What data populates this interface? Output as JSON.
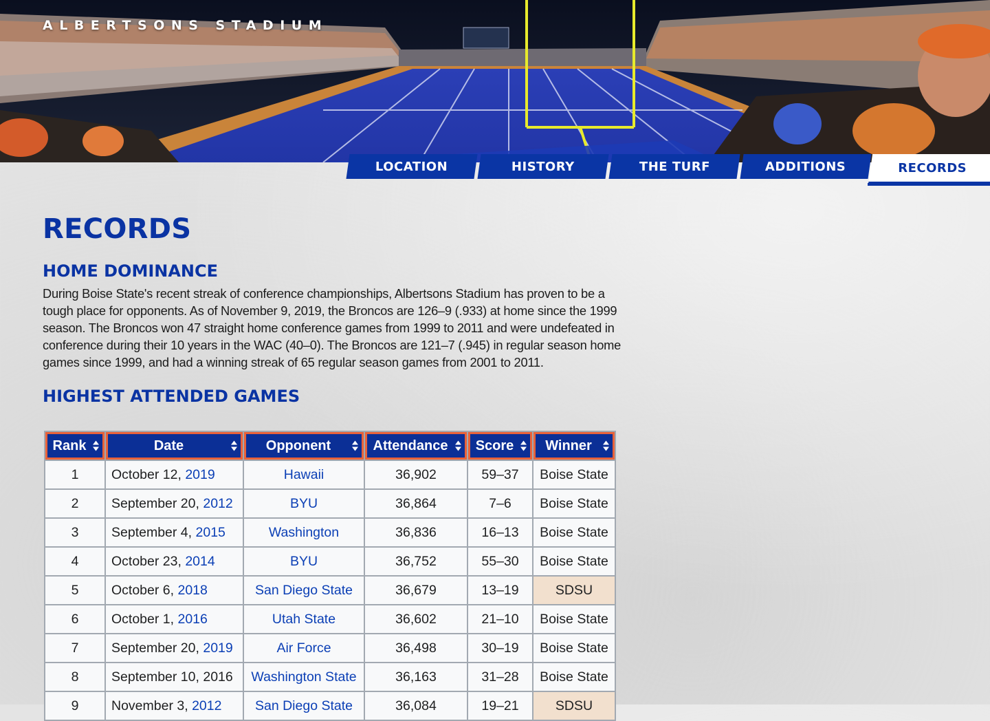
{
  "site": {
    "title": "ALBERTSONS STADIUM"
  },
  "nav": {
    "tabs": [
      {
        "label": "LOCATION",
        "active": false
      },
      {
        "label": "HISTORY",
        "active": false
      },
      {
        "label": "THE TURF",
        "active": false
      },
      {
        "label": "ADDITIONS",
        "active": false
      },
      {
        "label": "RECORDS",
        "active": true
      }
    ]
  },
  "page": {
    "title": "RECORDS",
    "section1": {
      "heading": "HOME DOMINANCE",
      "body": "During Boise State's recent streak of conference championships, Albertsons Stadium has proven to be a tough place for opponents. As of November 9, 2019, the Broncos are 126–9 (.933) at home since the 1999 season. The Broncos won 47 straight home conference games from 1999 to 2011 and were undefeated in conference during their 10 years in the WAC (40–0). The Broncos are 121–7 (.945) in regular season home games since 1999, and had a winning streak of 65 regular season games from 2001 to 2011."
    },
    "section2": {
      "heading": "HIGHEST ATTENDED GAMES"
    }
  },
  "table": {
    "columns": [
      "Rank",
      "Date",
      "Opponent",
      "Attendance",
      "Score",
      "Winner"
    ],
    "rows": [
      {
        "rank": "1",
        "date": "October 12,",
        "year": "2019",
        "year_linked": true,
        "opponent": "Hawaii",
        "attendance": "36,902",
        "score": "59–37",
        "winner": "Boise State",
        "winner_is_opponent": false
      },
      {
        "rank": "2",
        "date": "September 20,",
        "year": "2012",
        "year_linked": true,
        "opponent": "BYU",
        "attendance": "36,864",
        "score": "7–6",
        "winner": "Boise State",
        "winner_is_opponent": false
      },
      {
        "rank": "3",
        "date": "September 4,",
        "year": "2015",
        "year_linked": true,
        "opponent": "Washington",
        "attendance": "36,836",
        "score": "16–13",
        "winner": "Boise State",
        "winner_is_opponent": false
      },
      {
        "rank": "4",
        "date": "October 23,",
        "year": "2014",
        "year_linked": true,
        "opponent": "BYU",
        "attendance": "36,752",
        "score": "55–30",
        "winner": "Boise State",
        "winner_is_opponent": false
      },
      {
        "rank": "5",
        "date": "October 6,",
        "year": "2018",
        "year_linked": true,
        "opponent": "San Diego State",
        "attendance": "36,679",
        "score": "13–19",
        "winner": "SDSU",
        "winner_is_opponent": true
      },
      {
        "rank": "6",
        "date": "October 1,",
        "year": "2016",
        "year_linked": true,
        "opponent": "Utah State",
        "attendance": "36,602",
        "score": "21–10",
        "winner": "Boise State",
        "winner_is_opponent": false
      },
      {
        "rank": "7",
        "date": "September 20,",
        "year": "2019",
        "year_linked": true,
        "opponent": "Air Force",
        "attendance": "36,498",
        "score": "30–19",
        "winner": "Boise State",
        "winner_is_opponent": false
      },
      {
        "rank": "8",
        "date": "September 10,",
        "year": "2016",
        "year_linked": false,
        "opponent": "Washington State",
        "attendance": "36,163",
        "score": "31–28",
        "winner": "Boise State",
        "winner_is_opponent": false
      },
      {
        "rank": "9",
        "date": "November 3,",
        "year": "2012",
        "year_linked": true,
        "opponent": "San Diego State",
        "attendance": "36,084",
        "score": "19–21",
        "winner": "SDSU",
        "winner_is_opponent": true
      }
    ]
  },
  "colors": {
    "brand_blue": "#0a35a5",
    "accent_orange": "#e8623a",
    "link_blue": "#0b3fb5",
    "opponent_win_bg": "#f2e0ce"
  },
  "icons": {
    "sort": "sort-arrows-icon"
  }
}
